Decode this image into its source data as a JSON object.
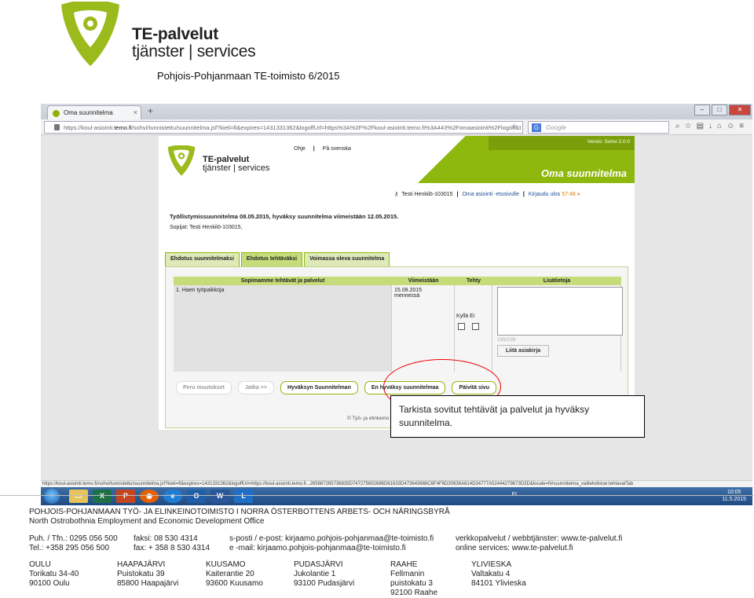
{
  "header": {
    "brand_line1": "TE-palvelut",
    "brand_line2": "tjänster | services",
    "subtitle": "Pohjois-Pohjanmaan TE-toimisto 6/2015",
    "logo_color": "#9bbb1d"
  },
  "browser": {
    "tab_title": "Oma suunnitelma",
    "url_prefix": "https://koul-asiointi.",
    "url_domain": "temo.fi",
    "url_rest": "/sohvi/tunnistettu/suunnitelma.jsf?kieli=fi&expires=1431331362&logoffUrl=https%3A%2F%2Fkoul-asiointi.temo.fi%3A443%2Fomaasiointi%2Flogoff&t",
    "search_placeholder": "Google",
    "search_engine_icon": "G",
    "status_url": "https://koul-asiointi.temo.fi/sohvi/tunnistettu/suunnitelma.jsf?kieli=fi&expires=1431331362&logoffUrl=https://koul-asiointi.temo.fi...265667265736835D747275652686D61633D473643666C6F4F6D30636A614D34777A52444279673D3D&locale=fi#suunnitelma_valitehdistoe:tehtavatTab"
  },
  "app": {
    "version": "Versio: Sohvi 2.0.0",
    "title": "Oma suunnitelma",
    "brand_line1": "TE-palvelut",
    "brand_line2": "tjänster | services",
    "help_link": "Ohje",
    "lang_link": "På svenska",
    "user": "Testi Henkilö-103015",
    "home_link": "Oma asiointi -etusivulle",
    "logout_link": "Kirjaudu ulos",
    "timer": "57:48",
    "plan_title": "Työllistymissuunnitelma 08.05.2015, hyväksy suunnitelma viimeistään 12.05.2015.",
    "parties": "Sopijat: Testi Henkilö-103015,",
    "tabs": [
      {
        "label": "Ehdotus suunnitelmaksi"
      },
      {
        "label": "Ehdotus tehtäväksi"
      },
      {
        "label": "Voimassa oleva suunnitelma"
      }
    ],
    "table": {
      "headers": [
        "Sopimamme tehtävät ja palvelut",
        "Viimeistään",
        "Tehty",
        "Lisätietoja"
      ],
      "row": {
        "task": "1. Haen työpaikkoja",
        "deadline": "15.08.2015",
        "deadline_note": "mennessä",
        "yes_label": "Kyllä",
        "no_label": "Ei",
        "counter": "239/239",
        "attach_button": "Liitä asiakirja"
      }
    },
    "buttons": {
      "cancel": "Peru muutokset",
      "continue": "Jatka >>",
      "approve": "Hyväksyn Suunnitelman",
      "reject": "En hyväksy suunnitelmaa",
      "refresh": "Päivitä sivu"
    },
    "copyright": "© Työ- ja elinkeino"
  },
  "callout": {
    "text": "Tarkista sovitut tehtävät ja palvelut ja hyväksy suunnitelma."
  },
  "taskbar": {
    "lang": "FI",
    "time": "10:05",
    "date": "11.5.2015",
    "apps": [
      "explorer",
      "excel",
      "powerpoint",
      "firefox",
      "ie",
      "outlook",
      "word",
      "lync"
    ]
  },
  "footer": {
    "org_line1": "POHJOIS-POHJANMAAN TYÖ- JA ELINKEINOTOIMISTO  I  NORRA ÖSTERBOTTENS ARBETS- OCH NÄRINGSBYRÅ",
    "org_line2": "North Ostrobothnia Employment and Economic Development Office",
    "phone_fi": "Puh. / Tfn.: 0295 056 500",
    "phone_en": "Tel.: +358 295 056 500",
    "fax_fi": "faksi: 08 530 4314",
    "fax_en": "fax: + 358 8 530 4314",
    "email_fi": "s-posti / e-post: kirjaamo.pohjois-pohjanmaa@te-toimisto.fi",
    "email_en": "e -mail: kirjaamo.pohjois-pohjanmaa@te-toimisto.fi",
    "web_fi": "verkkopalvelut / webbtjänster: www.te-palvelut.fi",
    "web_en": "online services: www.te-palvelut.fi",
    "offices": [
      {
        "city": "OULU",
        "street": "Torikatu 34-40",
        "postal": "90100 Oulu",
        "extra": ""
      },
      {
        "city": "HAAPAJÄRVI",
        "street": "Puistokatu 39",
        "postal": "85800 Haapajärvi",
        "extra": ""
      },
      {
        "city": "KUUSAMO",
        "street": "Kaiterantie 20",
        "postal": "93600 Kuusamo",
        "extra": ""
      },
      {
        "city": "PUDASJÄRVI",
        "street": "Jukolantie 1",
        "postal": "93100 Pudasjärvi",
        "extra": ""
      },
      {
        "city": "RAAHE",
        "street": "Fellmanin",
        "postal": "puistokatu 3",
        "extra": "92100 Raahe"
      },
      {
        "city": "YLIVIESKA",
        "street": "Valtakatu 4",
        "postal": "84101 Ylivieska",
        "extra": ""
      }
    ]
  }
}
